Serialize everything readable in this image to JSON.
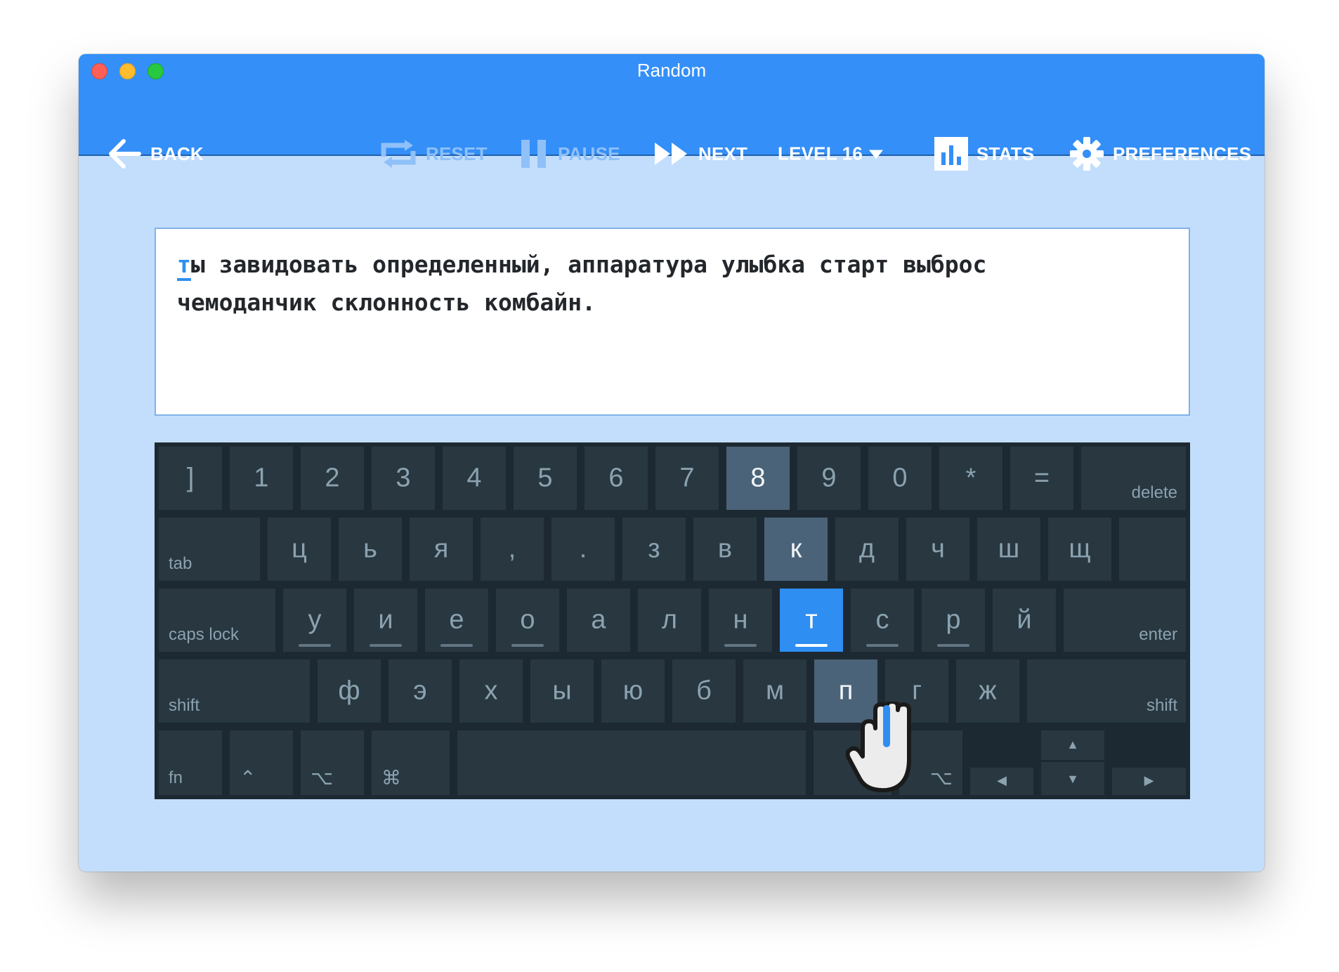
{
  "window": {
    "title": "Random"
  },
  "toolbar": {
    "back_label": "BACK",
    "reset_label": "RESET",
    "pause_label": "PAUSE",
    "next_label": "NEXT",
    "level_label": "LEVEL 16",
    "stats_label": "STATS",
    "preferences_label": "PREFERENCES"
  },
  "lesson": {
    "current_char": "т",
    "line1_rest": "ы завидовать определенный, аппаратура улыбка старт выброс",
    "line2": "чемоданчик склонность комбайн."
  },
  "keyboard": {
    "row1": [
      "]",
      "1",
      "2",
      "3",
      "4",
      "5",
      "6",
      "7",
      "8",
      "9",
      "0",
      "*",
      "=",
      "delete"
    ],
    "row2": [
      "tab",
      "ц",
      "ь",
      "я",
      ",",
      ".",
      "з",
      "в",
      "к",
      "д",
      "ч",
      "ш",
      "щ",
      ""
    ],
    "row3": [
      "caps lock",
      "у",
      "и",
      "е",
      "о",
      "а",
      "л",
      "н",
      "т",
      "с",
      "р",
      "й",
      "enter"
    ],
    "row4": [
      "shift",
      "ф",
      "э",
      "х",
      "ы",
      "ю",
      "б",
      "м",
      "п",
      "г",
      "ж",
      "shift"
    ],
    "row5": [
      "fn",
      "⌃",
      "⌥",
      "⌘",
      "",
      "⌘",
      "⌥"
    ],
    "arrows": {
      "left": "◀",
      "up": "▲",
      "down": "▼",
      "right": "▶"
    },
    "active_key": "т",
    "highlighted_keys": [
      "8",
      "к",
      "п"
    ]
  },
  "colors": {
    "toolbar": "#348ff8",
    "background": "#c3defc",
    "keyboard": "#1d2932",
    "key": "#283740",
    "key_highlight": "#4b6378",
    "key_active": "#2e8ef2"
  }
}
